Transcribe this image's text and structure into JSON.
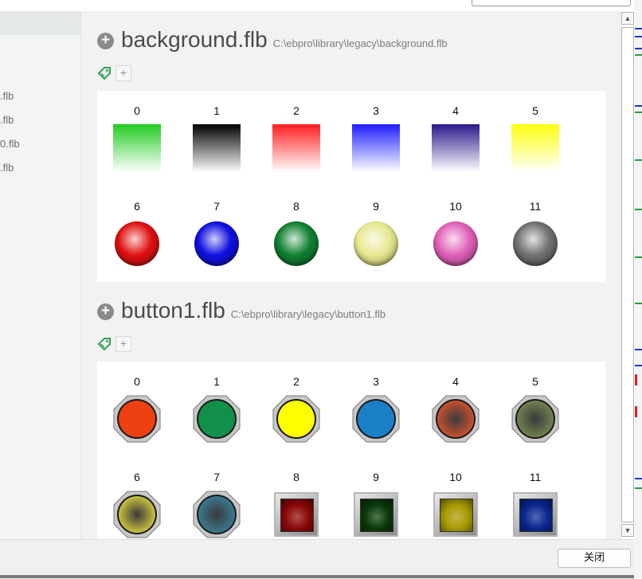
{
  "left_panel": {
    "items": [
      ".flb",
      ".flb",
      "0.flb",
      ".flb"
    ]
  },
  "libraries": [
    {
      "title": "background.flb",
      "path": "C:\\ebpro\\library\\legacy\\background.flb",
      "items": [
        {
          "label": "0",
          "kind": "gradient",
          "color": "#22cc22"
        },
        {
          "label": "1",
          "kind": "gradient",
          "color": "#000000"
        },
        {
          "label": "2",
          "kind": "gradient",
          "color": "#ff1e1e"
        },
        {
          "label": "3",
          "kind": "gradient",
          "color": "#1e1eff"
        },
        {
          "label": "4",
          "kind": "gradient",
          "color": "#2a1a8c"
        },
        {
          "label": "5",
          "kind": "gradient",
          "color": "#ffff10"
        },
        {
          "label": "6",
          "kind": "sphere",
          "color": "#e01010"
        },
        {
          "label": "7",
          "kind": "sphere",
          "color": "#1010e0"
        },
        {
          "label": "8",
          "kind": "sphere",
          "color": "#108030"
        },
        {
          "label": "9",
          "kind": "sphere",
          "color": "#e8e890"
        },
        {
          "label": "10",
          "kind": "sphere",
          "color": "#e060b8"
        },
        {
          "label": "11",
          "kind": "sphere",
          "color": "#707070"
        }
      ]
    },
    {
      "title": "button1.flb",
      "path": "C:\\ebpro\\library\\legacy\\button1.flb",
      "items": [
        {
          "label": "0",
          "kind": "octagon",
          "color": "#ee4010"
        },
        {
          "label": "1",
          "kind": "octagon",
          "color": "#109048"
        },
        {
          "label": "2",
          "kind": "octagon",
          "color": "#ffff00"
        },
        {
          "label": "3",
          "kind": "octagon",
          "color": "#1a80c8"
        },
        {
          "label": "4",
          "kind": "octagon-dark",
          "color": "#c85030"
        },
        {
          "label": "5",
          "kind": "octagon-dark",
          "color": "#708050"
        },
        {
          "label": "6",
          "kind": "octagon-dark",
          "color": "#c8c040"
        },
        {
          "label": "7",
          "kind": "octagon-dark",
          "color": "#3a7890"
        },
        {
          "label": "8",
          "kind": "square",
          "color": "#8a0808"
        },
        {
          "label": "9",
          "kind": "square",
          "color": "#0a3a0a"
        },
        {
          "label": "10",
          "kind": "square",
          "color": "#a89a00"
        },
        {
          "label": "11",
          "kind": "square",
          "color": "#0a2890"
        }
      ]
    }
  ],
  "footer": {
    "close_label": "关闭"
  },
  "colors": {
    "tag_icon": "#2fa05a",
    "content_bg": "#f2f2f2",
    "card_bg": "#ffffff"
  },
  "icons": {
    "expand": "plus-circle-icon",
    "tag": "tag-icon",
    "add": "plus-icon"
  }
}
